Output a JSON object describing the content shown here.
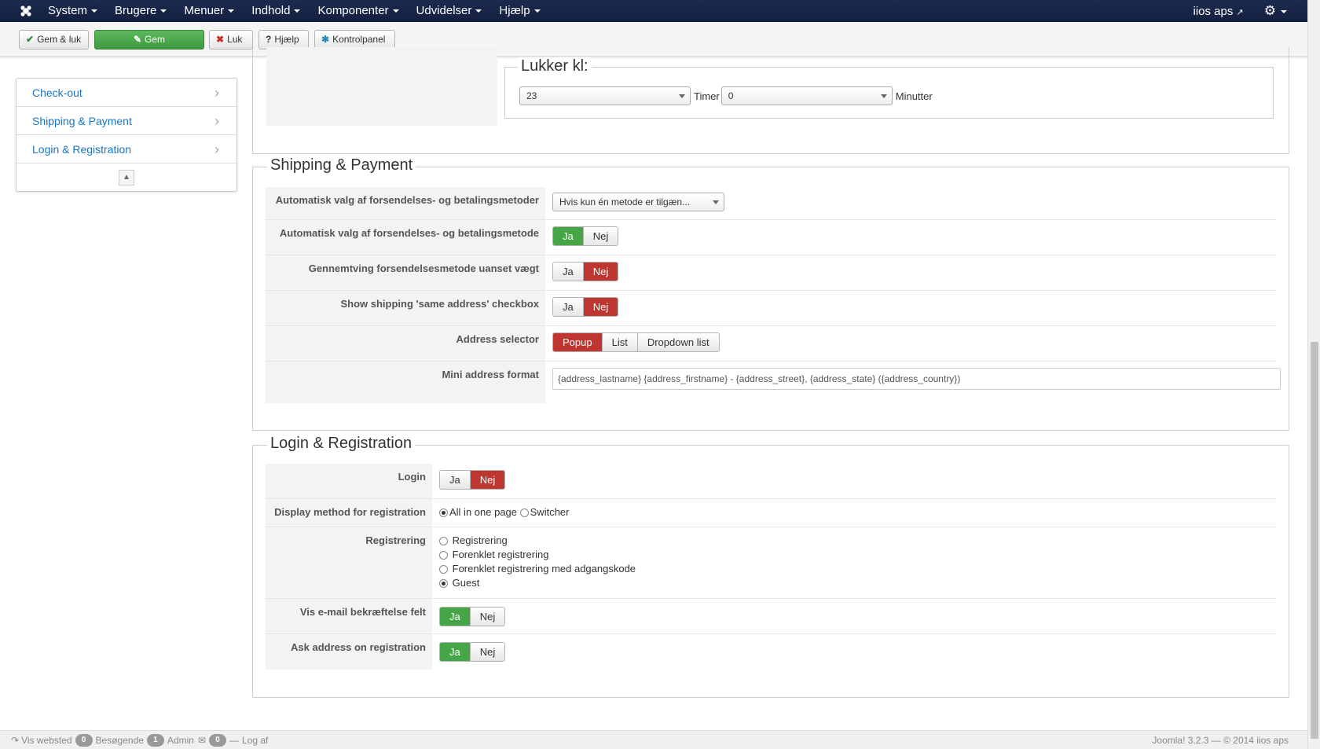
{
  "nav": {
    "menu": [
      "System",
      "Brugere",
      "Menuer",
      "Indhold",
      "Komponenter",
      "Udvidelser",
      "Hjælp"
    ],
    "site_link": "iios aps",
    "gear_icon": "gear-icon"
  },
  "toolbar": {
    "save_close": "Gem & luk",
    "save": "Gem",
    "close": "Luk",
    "help": "Hjælp",
    "control_panel": "Kontrolpanel"
  },
  "sidebar": {
    "items": [
      {
        "label": "Check-out"
      },
      {
        "label": "Shipping & Payment"
      },
      {
        "label": "Login & Registration"
      }
    ]
  },
  "closing": {
    "legend": "Lukker kl:",
    "hours_value": "23",
    "hours_label": "Timer",
    "minutes_value": "0",
    "minutes_label": "Minutter"
  },
  "shipping": {
    "legend": "Shipping & Payment",
    "auto_select_label": "Automatisk valg af forsendelses- og betalingsmetoder",
    "auto_select_value": "Hvis kun én metode er tilgæn...",
    "auto_select_single_label": "Automatisk valg af forsendelses- og betalingsmetode",
    "force_shipping_label": "Gennemtving forsendelsesmetode uanset vægt",
    "same_address_label": "Show shipping 'same address' checkbox",
    "address_selector_label": "Address selector",
    "address_options": [
      "Popup",
      "List",
      "Dropdown list"
    ],
    "mini_address_label": "Mini address format",
    "mini_address_value": "{address_lastname} {address_firstname} - {address_street}, {address_state} ({address_country})"
  },
  "login": {
    "legend": "Login & Registration",
    "login_label": "Login",
    "display_method_label": "Display method for registration",
    "display_options": [
      "All in one page",
      "Switcher"
    ],
    "registration_label": "Registrering",
    "registration_options": [
      "Registrering",
      "Forenklet registrering",
      "Forenklet registrering med adgangskode",
      "Guest"
    ],
    "email_confirm_label": "Vis e-mail bekræftelse felt",
    "ask_address_label": "Ask address on registration"
  },
  "toggle": {
    "yes": "Ja",
    "no": "Nej"
  },
  "footer": {
    "view_site": "Vis websted",
    "visitors_count": "0",
    "visitors_label": "Besøgende",
    "admin_count": "1",
    "admin_label": "Admin",
    "messages_count": "0",
    "logout": "Log af",
    "version": "Joomla! 3.2.3 — © 2014 iios aps"
  }
}
